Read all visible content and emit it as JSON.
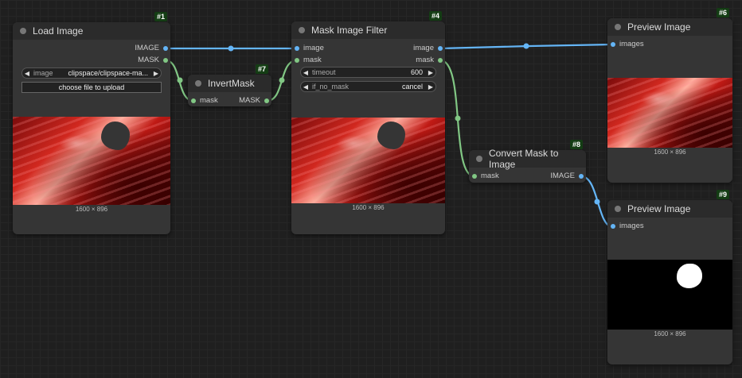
{
  "nodes": {
    "load_image": {
      "badge": "#1",
      "title": "Load Image",
      "outputs": [
        "IMAGE",
        "MASK"
      ],
      "image_widget": {
        "label": "image",
        "value": "clipspace/clipspace-ma..."
      },
      "upload_label": "choose file to upload",
      "size": "1600 × 896"
    },
    "invert_mask": {
      "badge": "#7",
      "title": "InvertMask",
      "input": "mask",
      "output": "MASK"
    },
    "mask_filter": {
      "badge": "#4",
      "title": "Mask Image Filter",
      "inputs": [
        "image",
        "mask"
      ],
      "outputs": [
        "image",
        "mask"
      ],
      "timeout": {
        "label": "timeout",
        "value": "600"
      },
      "if_no_mask": {
        "label": "if_no_mask",
        "value": "cancel"
      },
      "size": "1600 × 896"
    },
    "convert_mask": {
      "badge": "#8",
      "title": "Convert Mask to Image",
      "input": "mask",
      "output": "IMAGE"
    },
    "preview_1": {
      "badge": "#6",
      "title": "Preview Image",
      "input": "images",
      "size": "1600 × 896"
    },
    "preview_2": {
      "badge": "#9",
      "title": "Preview Image",
      "input": "images",
      "size": "1600 × 896"
    }
  },
  "colors": {
    "image_link": "#64b5f6",
    "mask_link": "#81c784",
    "badge_bg": "#143d14"
  }
}
